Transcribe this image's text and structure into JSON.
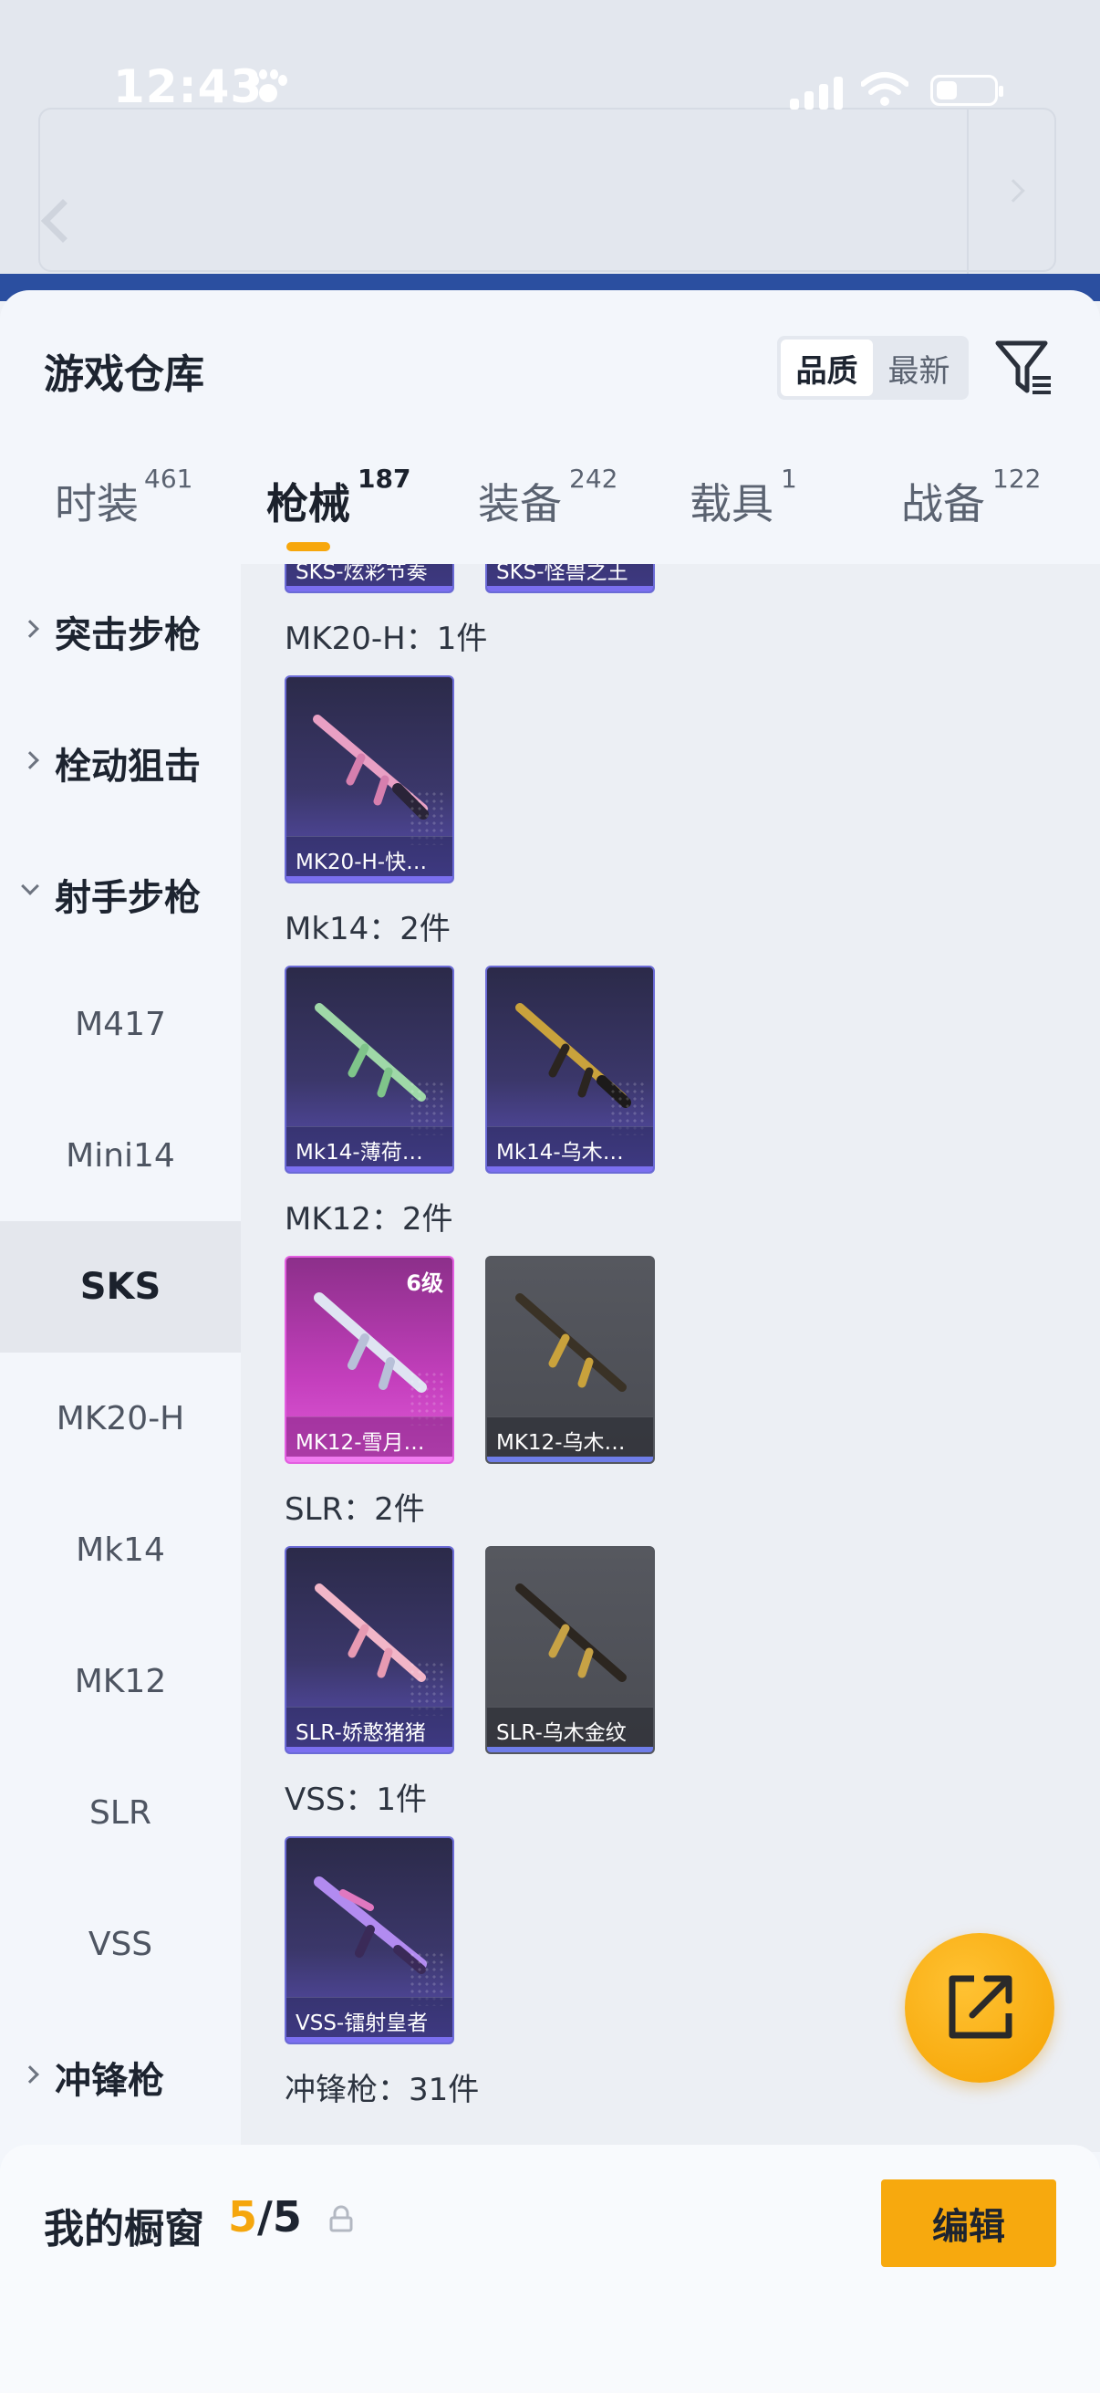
{
  "status_bar": {
    "time": "12:43"
  },
  "header": {
    "title": "游戏仓库",
    "sort_options": [
      "品质",
      "最新"
    ],
    "active_sort": "品质"
  },
  "tabs": [
    {
      "label": "时装",
      "count": "461"
    },
    {
      "label": "枪械",
      "count": "187"
    },
    {
      "label": "装备",
      "count": "242"
    },
    {
      "label": "载具",
      "count": "1"
    },
    {
      "label": "战备",
      "count": "122"
    }
  ],
  "active_tab": "枪械",
  "sidebar": {
    "items": [
      {
        "label": "突击步枪",
        "type": "category",
        "expanded": false
      },
      {
        "label": "栓动狙击",
        "type": "category",
        "expanded": false
      },
      {
        "label": "射手步枪",
        "type": "category",
        "expanded": true
      },
      {
        "label": "M417",
        "type": "sub"
      },
      {
        "label": "Mini14",
        "type": "sub"
      },
      {
        "label": "SKS",
        "type": "sub",
        "active": true
      },
      {
        "label": "MK20-H",
        "type": "sub"
      },
      {
        "label": "Mk14",
        "type": "sub"
      },
      {
        "label": "MK12",
        "type": "sub"
      },
      {
        "label": "SLR",
        "type": "sub"
      },
      {
        "label": "VSS",
        "type": "sub"
      },
      {
        "label": "冲锋枪",
        "type": "category",
        "expanded": false
      }
    ]
  },
  "content": {
    "partial_cards": [
      "SKS-炫彩节奏",
      "SKS-怪兽之王"
    ],
    "groups": [
      {
        "label": "MK20-H：1件",
        "items": [
          {
            "name": "MK20-H-快…",
            "style": "purple"
          }
        ]
      },
      {
        "label": "Mk14：2件",
        "items": [
          {
            "name": "Mk14-薄荷…",
            "style": "purple"
          },
          {
            "name": "Mk14-乌木…",
            "style": "purple"
          }
        ]
      },
      {
        "label": "MK12：2件",
        "items": [
          {
            "name": "MK12-雪月…",
            "style": "pink",
            "level": "6级"
          },
          {
            "name": "MK12-乌木…",
            "style": "gray"
          }
        ]
      },
      {
        "label": "SLR：2件",
        "items": [
          {
            "name": "SLR-娇憨猪猪",
            "style": "purple"
          },
          {
            "name": "SLR-乌木金纹",
            "style": "gray"
          }
        ]
      },
      {
        "label": "VSS：1件",
        "items": [
          {
            "name": "VSS-镭射皇者",
            "style": "purple"
          }
        ]
      }
    ],
    "trailing_label": "冲锋枪：31件"
  },
  "bottom_bar": {
    "label": "我的橱窗",
    "current": "5",
    "total": "/5",
    "edit_label": "编辑"
  },
  "colors": {
    "accent": "#f7a90e",
    "sheet_bg": "#f3f6fb",
    "content_bg": "#eceff4"
  },
  "icons": [
    "back-icon",
    "filter-icon",
    "lock-icon",
    "share-icon",
    "chevron-right-icon",
    "chevron-down-icon"
  ]
}
